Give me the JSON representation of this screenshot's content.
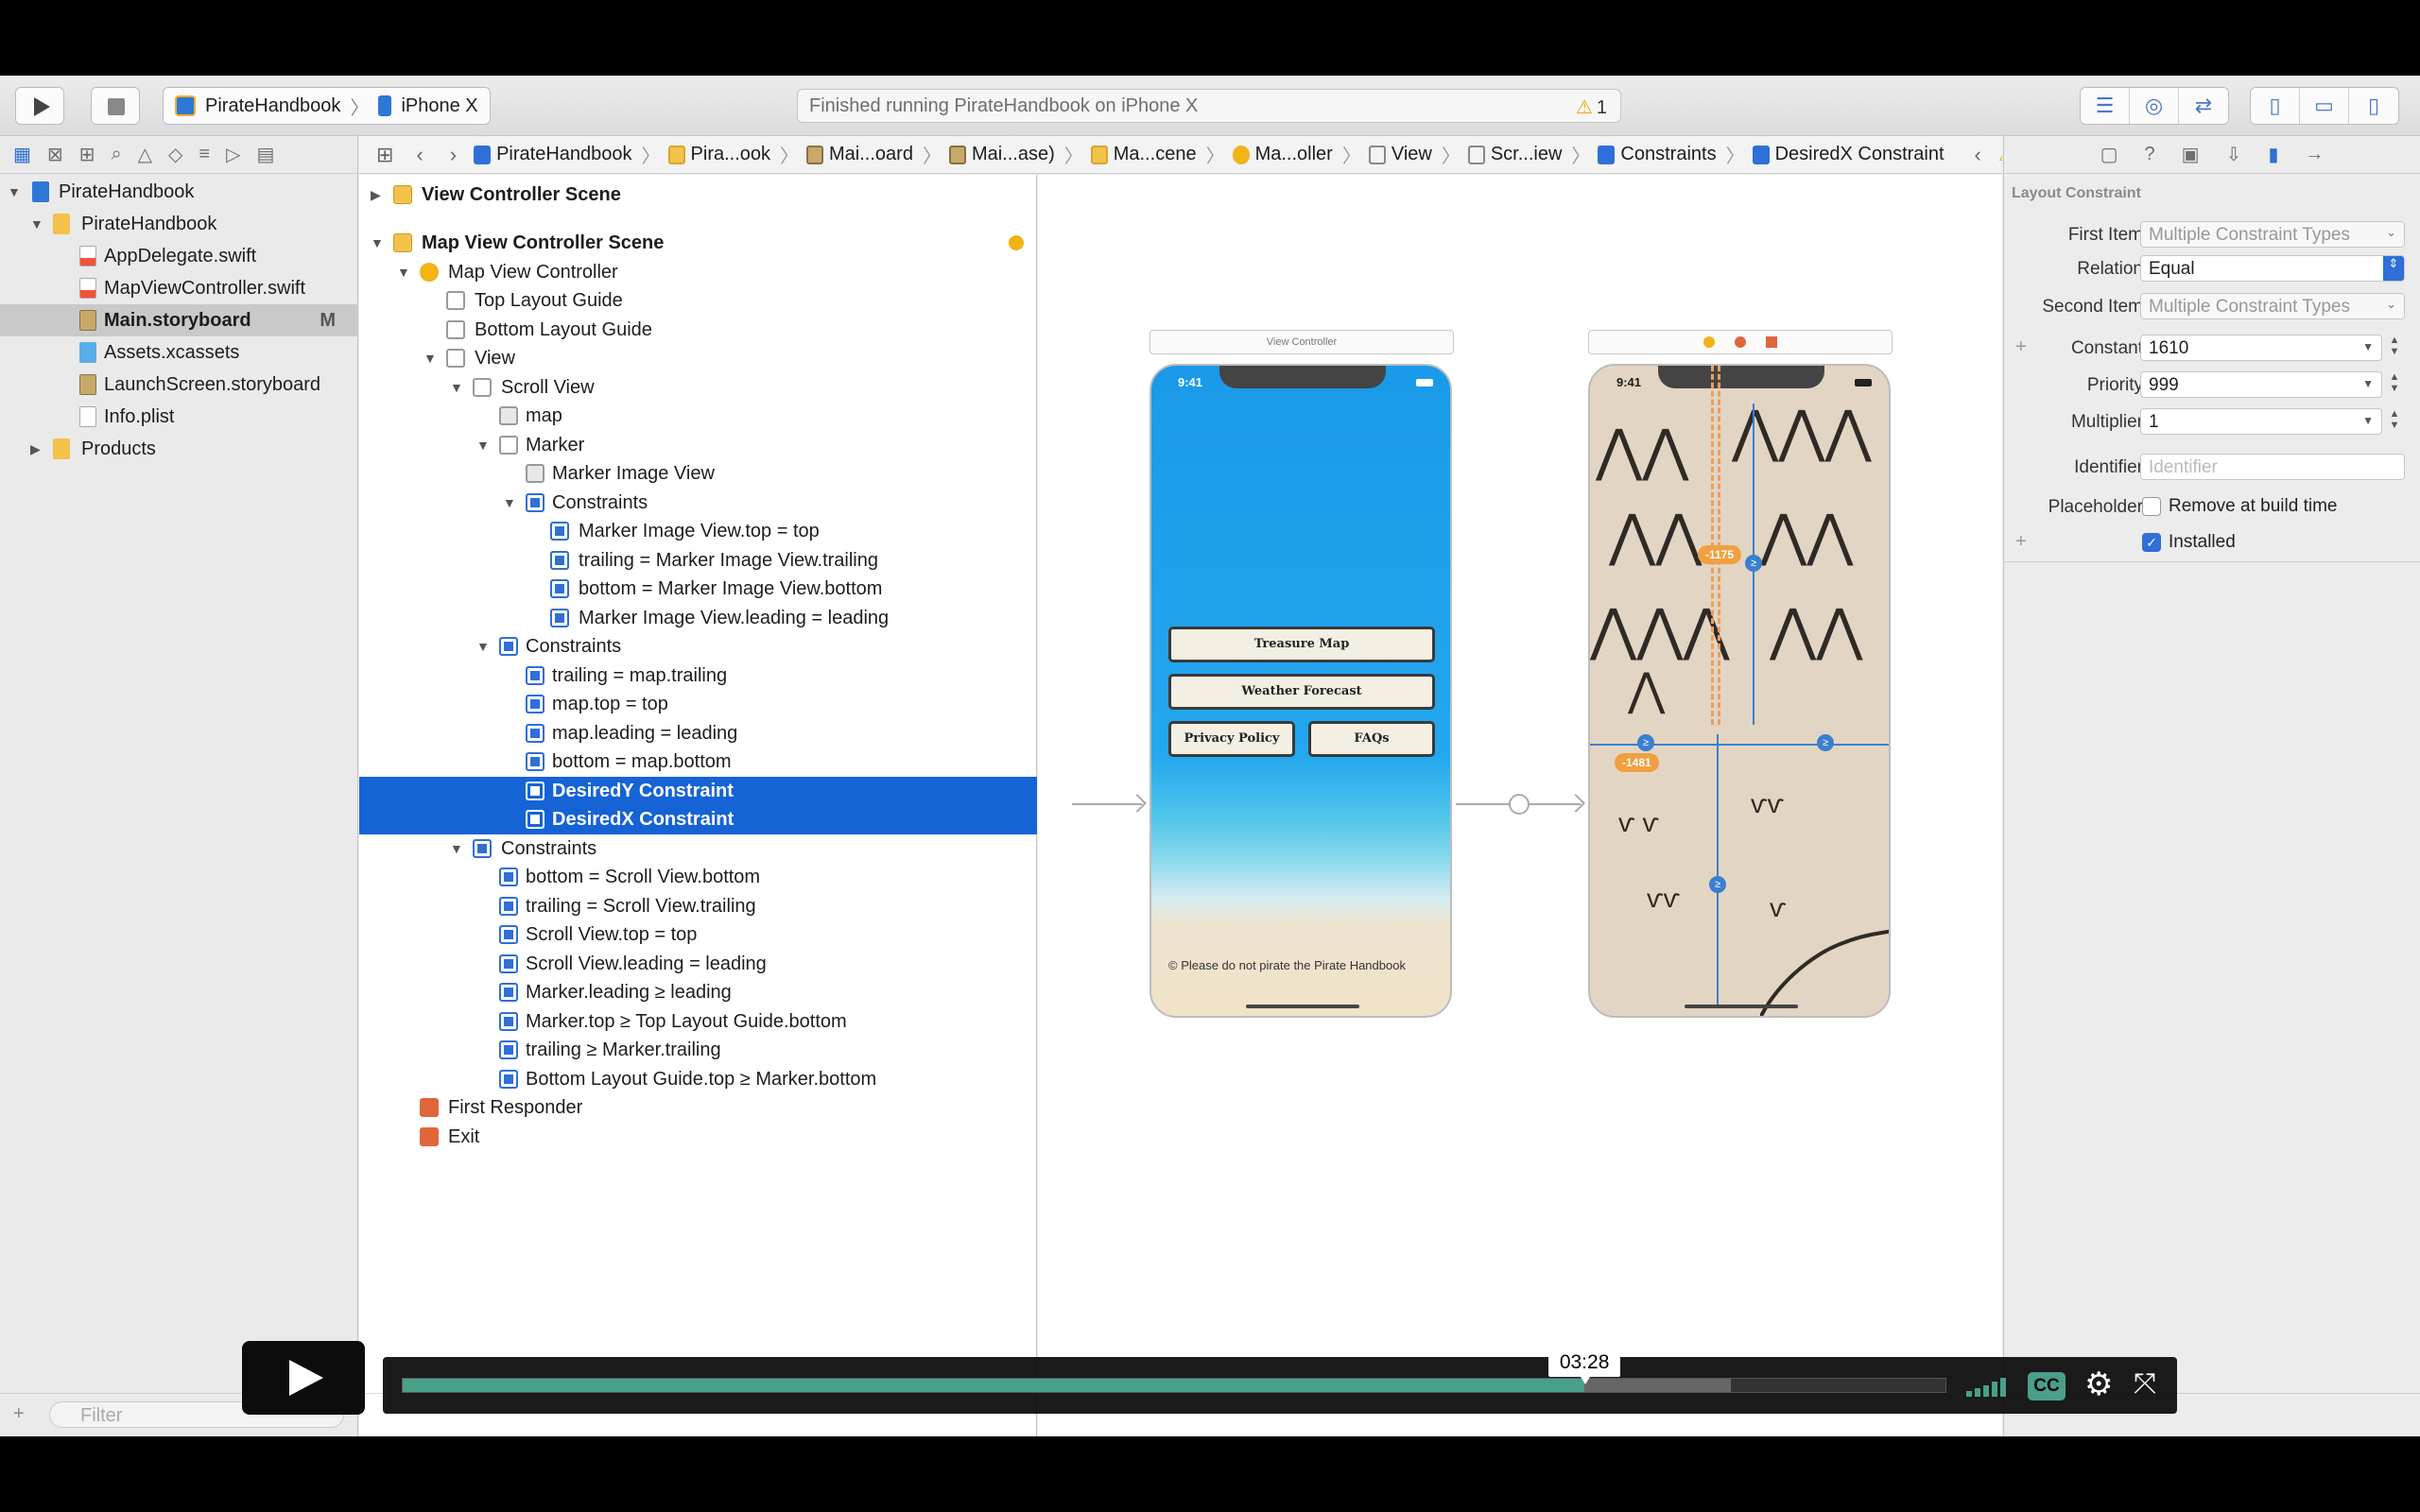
{
  "toolbar": {
    "scheme_app": "PirateHandbook",
    "scheme_device": "iPhone X",
    "status_text": "Finished running PirateHandbook on iPhone X",
    "warning_count": "1"
  },
  "navigator": {
    "files": [
      {
        "label": "PirateHandbook",
        "badge": ""
      },
      {
        "label": "PirateHandbook",
        "badge": ""
      },
      {
        "label": "AppDelegate.swift",
        "badge": ""
      },
      {
        "label": "MapViewController.swift",
        "badge": ""
      },
      {
        "label": "Main.storyboard",
        "badge": "M"
      },
      {
        "label": "Assets.xcassets",
        "badge": ""
      },
      {
        "label": "LaunchScreen.storyboard",
        "badge": ""
      },
      {
        "label": "Info.plist",
        "badge": ""
      },
      {
        "label": "Products",
        "badge": ""
      }
    ],
    "filter_placeholder": "Filter"
  },
  "jumpbar": {
    "crumbs": [
      "PirateHandbook",
      "Pira...ook",
      "Mai...oard",
      "Mai...ase)",
      "Ma...cene",
      "Ma...oller",
      "View",
      "Scr...iew",
      "Constraints",
      "DesiredX Constraint"
    ]
  },
  "outline": {
    "rows": [
      "View Controller Scene",
      "Map View Controller Scene",
      "Map View Controller",
      "Top Layout Guide",
      "Bottom Layout Guide",
      "View",
      "Scroll View",
      "map",
      "Marker",
      "Marker Image View",
      "Constraints",
      "Marker Image View.top = top",
      "trailing = Marker Image View.trailing",
      "bottom = Marker Image View.bottom",
      "Marker Image View.leading = leading",
      "Constraints",
      "trailing = map.trailing",
      "map.top = top",
      "map.leading = leading",
      "bottom = map.bottom",
      "DesiredY Constraint",
      "DesiredX Constraint",
      "Constraints",
      "bottom = Scroll View.bottom",
      "trailing = Scroll View.trailing",
      "Scroll View.top = top",
      "Scroll View.leading = leading",
      "Marker.leading ≥ leading",
      "Marker.top ≥ Top Layout Guide.bottom",
      "trailing ≥ Marker.trailing",
      "Bottom Layout Guide.top ≥ Marker.bottom",
      "First Responder",
      "Exit"
    ]
  },
  "canvas": {
    "vc_scene_title": "View Controller",
    "phone_time": "9:41",
    "buttons": {
      "treasure": "Treasure Map",
      "weather": "Weather Forecast",
      "privacy": "Privacy Policy",
      "faqs": "FAQs"
    },
    "footer": "© Please do not pirate the Pirate Handbook",
    "constraint_y_value": "-1175",
    "constraint_x_value": "-1481"
  },
  "inspector": {
    "section_title": "Layout Constraint",
    "first_item_label": "First Item",
    "first_item_value": "Multiple Constraint Types",
    "relation_label": "Relation",
    "relation_value": "Equal",
    "second_item_label": "Second Item",
    "second_item_value": "Multiple Constraint Types",
    "constant_label": "Constant",
    "constant_value": "1610",
    "priority_label": "Priority",
    "priority_value": "999",
    "multiplier_label": "Multiplier",
    "multiplier_value": "1",
    "identifier_label": "Identifier",
    "identifier_placeholder": "Identifier",
    "placeholder_label": "Placeholder",
    "remove_at_build_label": "Remove at build time",
    "installed_label": "Installed"
  },
  "video": {
    "time": "03:28",
    "progress": 0.766,
    "buffered": 0.861,
    "cc_label": "CC"
  },
  "colors": {
    "selection": "#1663d6",
    "accent": "#2e6fd8",
    "video_progress": "#49a08a"
  }
}
